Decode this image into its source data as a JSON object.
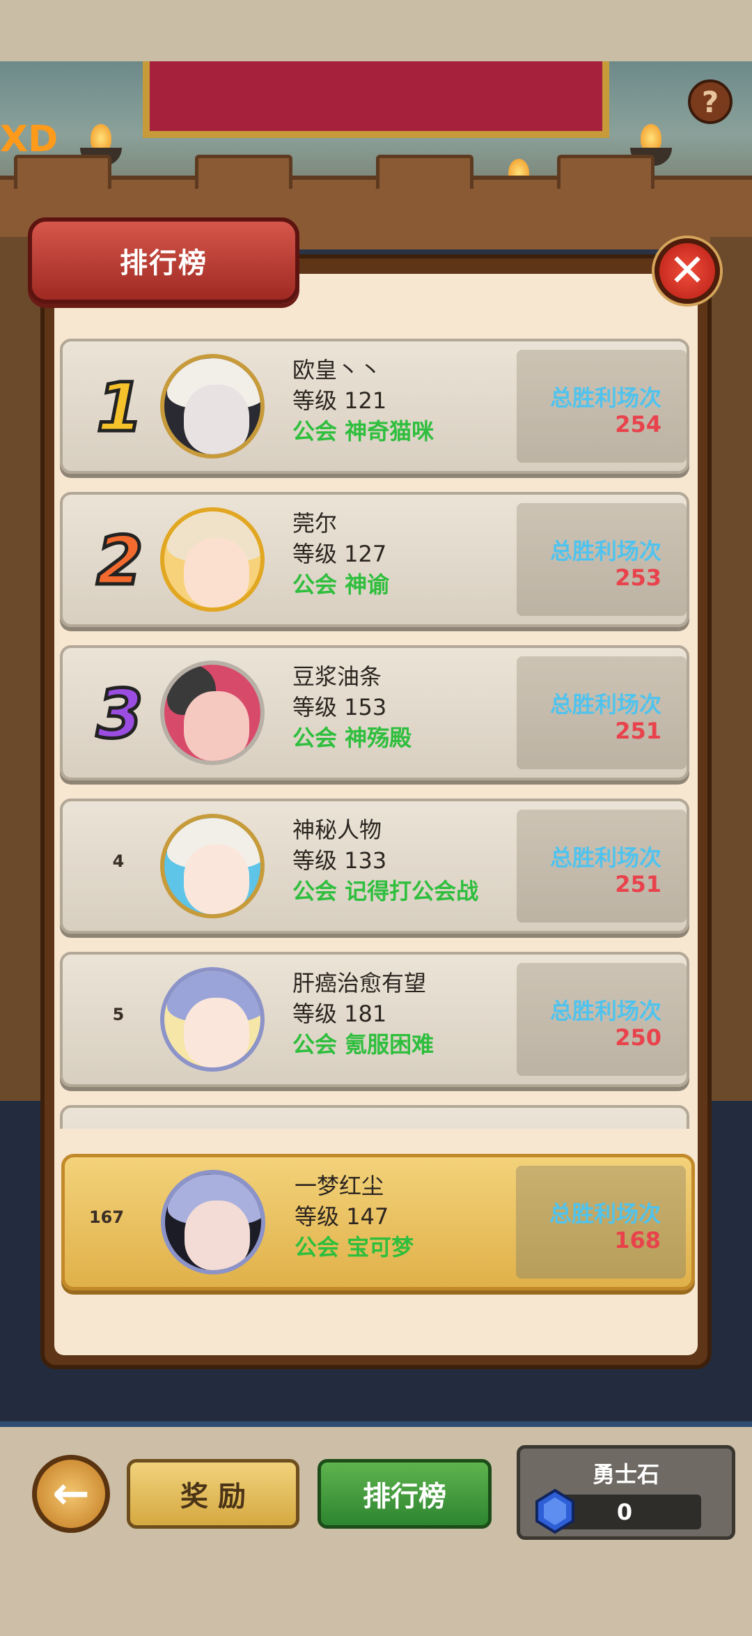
{
  "panel": {
    "title": "排行榜"
  },
  "rankings": [
    {
      "rank": "1",
      "name": "欧皇丶丶",
      "level": "等级 121",
      "guild": "公会 神奇猫咪",
      "wins_label": "总胜利场次",
      "wins": "254"
    },
    {
      "rank": "2",
      "name": "莞尔",
      "level": "等级 127",
      "guild": "公会 神谕",
      "wins_label": "总胜利场次",
      "wins": "253"
    },
    {
      "rank": "3",
      "name": "豆浆油条",
      "level": "等级 153",
      "guild": "公会 神殇殿",
      "wins_label": "总胜利场次",
      "wins": "251"
    },
    {
      "rank": "4",
      "name": "神秘人物",
      "level": "等级 133",
      "guild": "公会 记得打公会战",
      "wins_label": "总胜利场次",
      "wins": "251"
    },
    {
      "rank": "5",
      "name": "肝癌治愈有望",
      "level": "等级 181",
      "guild": "公会 氪服困难",
      "wins_label": "总胜利场次",
      "wins": "250"
    }
  ],
  "my_rank": {
    "rank": "167",
    "name": "一梦红尘",
    "level": "等级 147",
    "guild": "公会 宝可梦",
    "wins_label": "总胜利场次",
    "wins": "168"
  },
  "bottom": {
    "reward_label": "奖 励",
    "rank_label": "排行榜",
    "currency_label": "勇士石",
    "currency_value": "0"
  },
  "icons": {
    "help": "question-mark-icon",
    "close": "close-icon",
    "back": "arrow-left-icon",
    "gem": "blue-gem-icon"
  },
  "colors": {
    "wins_label": "#4fc3ee",
    "wins_value": "#e8434c",
    "guild": "#2fbe3d",
    "rank1": "#f6c22c",
    "rank2": "#f26a2e",
    "rank3": "#9a4de0"
  }
}
